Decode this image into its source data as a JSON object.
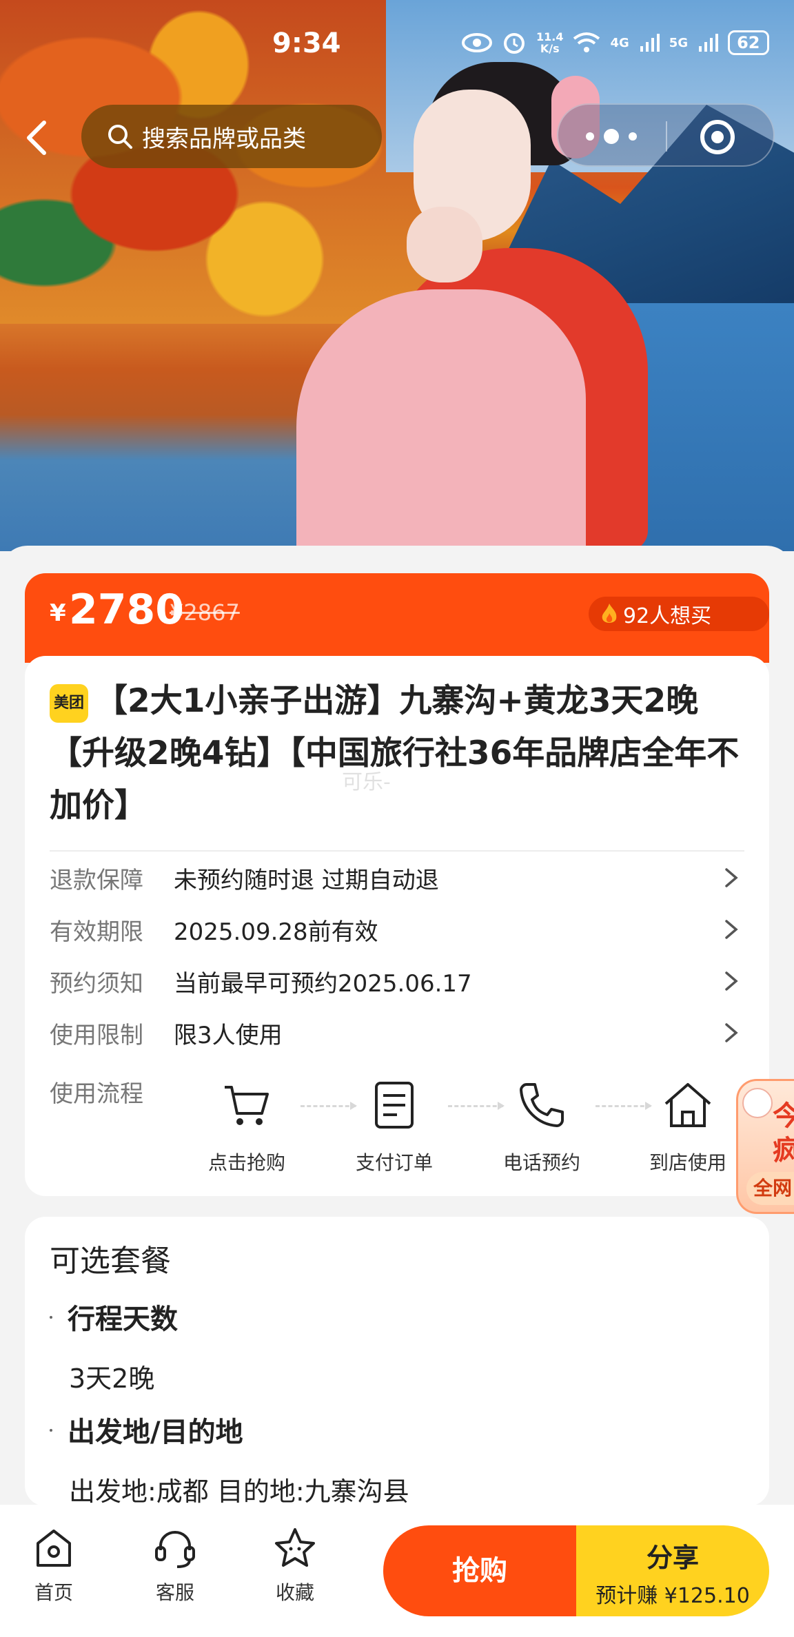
{
  "status_bar": {
    "time": "9:34",
    "net_speed_top": "11.4",
    "net_speed_bottom": "K/s",
    "sig1": "4G",
    "sig2": "5G",
    "battery": "62"
  },
  "header": {
    "search_placeholder": "搜索品牌或品类"
  },
  "price": {
    "currency": "¥",
    "current": "2780",
    "original": "¥2867",
    "want_buy": "92人想买",
    "accent_color": "#ff4d0f"
  },
  "product": {
    "brand_badge": "美团",
    "title": "【2大1小亲子出游】九寨沟+黄龙3天2晚【升级2晚4钻】【中国旅行社36年品牌店全年不加价】",
    "watermark": "可乐-"
  },
  "info_rows": [
    {
      "label": "退款保障",
      "value": "未预约随时退 过期自动退"
    },
    {
      "label": "有效期限",
      "value": "2025.09.28前有效"
    },
    {
      "label": "预约须知",
      "value": "当前最早可预约2025.06.17"
    },
    {
      "label": "使用限制",
      "value": "限3人使用"
    }
  ],
  "flow": {
    "label": "使用流程",
    "steps": [
      {
        "label": "点击抢购",
        "icon": "cart-icon"
      },
      {
        "label": "支付订单",
        "icon": "document-icon"
      },
      {
        "label": "电话预约",
        "icon": "phone-icon"
      },
      {
        "label": "到店使用",
        "icon": "home-icon"
      }
    ]
  },
  "float_badge": {
    "line1": "今",
    "line2": "疯",
    "line3": "全网"
  },
  "packages": {
    "heading": "可选套餐",
    "groups": [
      {
        "name": "行程天数",
        "value": "3天2晚"
      },
      {
        "name": "出发地/目的地",
        "value": "出发地:成都 目的地:九寨沟县"
      }
    ]
  },
  "bottom_bar": {
    "tabs": [
      {
        "label": "首页",
        "icon": "home-tab-icon"
      },
      {
        "label": "客服",
        "icon": "headset-icon"
      },
      {
        "label": "收藏",
        "icon": "star-icon"
      }
    ],
    "buy_label": "抢购",
    "share_label": "分享",
    "share_earn": "预计赚 ¥125.10",
    "share_color": "#ffd21f"
  }
}
